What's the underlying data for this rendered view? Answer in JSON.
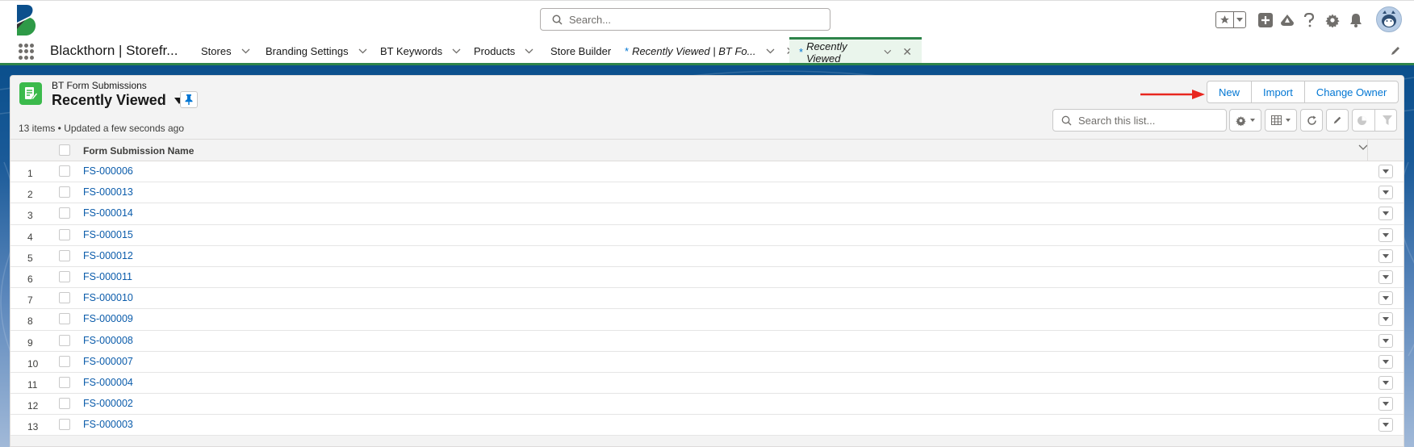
{
  "header": {
    "search_placeholder": "Search...",
    "icons": [
      "favorites-star-icon",
      "favorites-dropdown-icon",
      "global-actions-plus-icon",
      "trailhead-icon",
      "help-icon",
      "setup-gear-icon",
      "notifications-bell-icon",
      "user-avatar"
    ]
  },
  "nav": {
    "app_name": "Blackthorn | Storefr...",
    "items": [
      {
        "label": "Stores",
        "has_dropdown": true
      },
      {
        "label": "Branding Settings",
        "has_dropdown": true
      },
      {
        "label": "BT Keywords",
        "has_dropdown": true
      },
      {
        "label": "Products",
        "has_dropdown": true
      },
      {
        "label": "Store Builder",
        "has_dropdown": false
      }
    ],
    "tabs": [
      {
        "prefix": "*",
        "label": "Recently Viewed | BT Fo...",
        "active": false
      },
      {
        "prefix": "*",
        "label": "Recently Viewed",
        "active": true
      }
    ]
  },
  "list_view": {
    "object_label": "BT Form Submissions",
    "title": "Recently Viewed",
    "meta": "13 items • Updated a few seconds ago",
    "buttons": [
      "New",
      "Import",
      "Change Owner"
    ],
    "search_placeholder": "Search this list...",
    "column_header": "Form Submission Name",
    "rows": [
      {
        "num": "1",
        "name": "FS-000006"
      },
      {
        "num": "2",
        "name": "FS-000013"
      },
      {
        "num": "3",
        "name": "FS-000014"
      },
      {
        "num": "4",
        "name": "FS-000015"
      },
      {
        "num": "5",
        "name": "FS-000012"
      },
      {
        "num": "6",
        "name": "FS-000011"
      },
      {
        "num": "7",
        "name": "FS-000010"
      },
      {
        "num": "8",
        "name": "FS-000009"
      },
      {
        "num": "9",
        "name": "FS-000008"
      },
      {
        "num": "10",
        "name": "FS-000007"
      },
      {
        "num": "11",
        "name": "FS-000004"
      },
      {
        "num": "12",
        "name": "FS-000002"
      },
      {
        "num": "13",
        "name": "FS-000003"
      }
    ]
  },
  "colors": {
    "brand_blue": "#0b4f8c",
    "accent_green": "#2e844a",
    "link_blue": "#0b5cab",
    "object_icon_green": "#3bba4c",
    "annotation_arrow": "#e8261f"
  }
}
